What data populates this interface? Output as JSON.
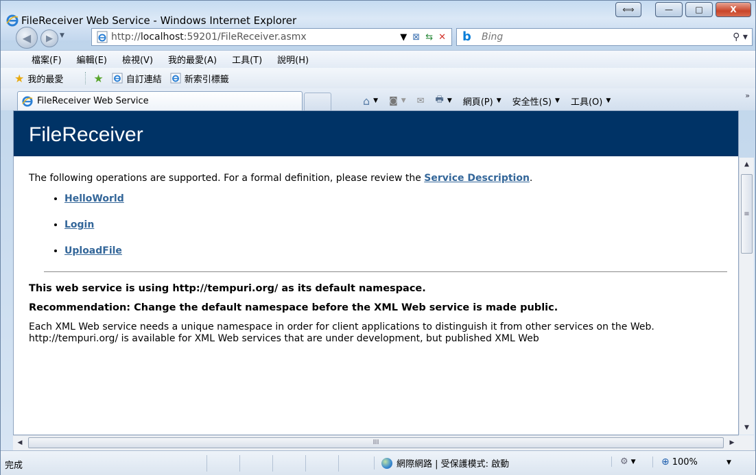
{
  "window": {
    "title": "FileReceiver Web Service - Windows Internet Explorer",
    "caption_switch": "⟺",
    "caption_min": "—",
    "caption_max": "□",
    "caption_close": "X"
  },
  "nav": {
    "url_prefix": "http://",
    "url_host": "localhost",
    "url_rest": ":59201/FileReceiver.asmx",
    "search_placeholder": "Bing",
    "search_icon": "🔍"
  },
  "menu": {
    "items": [
      "檔案(F)",
      "編輯(E)",
      "檢視(V)",
      "我的最愛(A)",
      "工具(T)",
      "說明(H)"
    ]
  },
  "favorites": {
    "favorites_label": "我的最愛",
    "custom_links_label": "自訂連結",
    "new_index_label": "新索引標籤"
  },
  "tab": {
    "title": "FileReceiver Web Service"
  },
  "commands": {
    "page_label": "網頁(P)",
    "safety_label": "安全性(S)",
    "tools_label": "工具(O)",
    "more": "»"
  },
  "page": {
    "heading": "FileReceiver",
    "intro": "The following operations are supported. For a formal definition, please review the ",
    "service_description": "Service Description",
    "intro_end": ".",
    "operations": [
      "HelloWorld",
      "Login",
      "UploadFile"
    ],
    "namespace_line": "This web service is using http://tempuri.org/ as its default namespace.",
    "recommendation_line": "Recommendation: Change the default namespace before the XML Web service is made public.",
    "paragraph": "Each XML Web service needs a unique namespace in order for client applications to distinguish it from other services on the Web. http://tempuri.org/ is available for XML Web services that are under development, but published XML Web"
  },
  "status": {
    "text": "完成",
    "zone": "網際網路 | 受保護模式: 啟動",
    "zoom": "100%"
  },
  "scroll": {
    "h_grip": "III",
    "v_grip": "≡"
  }
}
